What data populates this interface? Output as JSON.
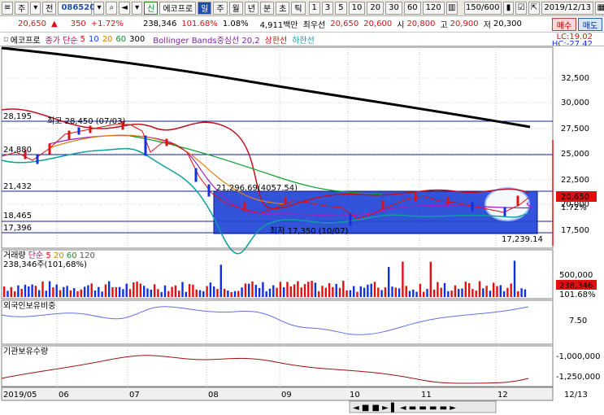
{
  "toolbar": {
    "menu_label": "주",
    "jeon_label": "전",
    "code": "086520",
    "sin_label": "신",
    "stock_name": "에코프로",
    "info_label": "일",
    "periods": [
      "주",
      "월",
      "년",
      "분",
      "초",
      "틱"
    ],
    "intervals": [
      "1",
      "3",
      "5",
      "10",
      "20",
      "30",
      "60",
      "120"
    ],
    "count": "150/600",
    "date": "2019/12/13"
  },
  "quote": {
    "price": "20,650",
    "change": "350",
    "change_pct": "+1.72%",
    "volume": "238,346",
    "vol_ratio": "101.68%",
    "turnover": "1.08%",
    "amount": "4,911백만",
    "best_ask_label": "최우선",
    "best_ask": "20,650",
    "best_bid": "20,600",
    "open_label": "시",
    "open": "20,800",
    "high_label": "고",
    "high": "20,900",
    "low_label": "저",
    "low": "20,300",
    "buy_label": "매수",
    "sell_label": "매도"
  },
  "legend": {
    "name": "에코프로",
    "ma_label": "종가 단순",
    "ma5": "5",
    "ma10": "10",
    "ma20": "20",
    "ma60": "60",
    "ma300": "300",
    "bb_label": "Bollinger Bands중심선 20,2",
    "bb_upper": "상한선",
    "bb_lower": "하한선",
    "lc": "LC:19.02",
    "hc": "HC:-27.42"
  },
  "price_axis": [
    "32,500",
    "30,000",
    "27,500",
    "25,000",
    "22,500",
    "20,000",
    "17,500"
  ],
  "price_levels": [
    "28,195",
    "24,880",
    "21,432",
    "18,465",
    "17,396"
  ],
  "annotations": {
    "high": "최고 28,450 (07/03)",
    "low": "최저 17,350 (10/07)",
    "mid": "21,296.69(4057.54)",
    "bottom_value": "17,239.14",
    "current_price": "20,650",
    "current_pct": "1.72%"
  },
  "volume_panel": {
    "label": "거래량",
    "ma_label": "단순",
    "ma5": "5",
    "ma20": "20",
    "ma60": "60",
    "ma120": "120",
    "value_text": "238,346주(101,68%)",
    "axis": "500,000",
    "current": "238,346",
    "current_pct": "101.68%"
  },
  "foreign_panel": {
    "label": "외국인보유비중",
    "axis": "7.50"
  },
  "inst_panel": {
    "label": "기관보유수량",
    "axis": [
      "-1,000,000",
      "-1,250,000"
    ]
  },
  "x_axis": [
    "2019/05",
    "06",
    "07",
    "08",
    "09",
    "10",
    "11",
    "12",
    "12/13"
  ],
  "colors": {
    "up": "#e01010",
    "down": "#1030e0",
    "box": "#1f3fd0",
    "ma300": "#000000",
    "bb": "#c01020"
  },
  "chart_data": [
    {
      "type": "line",
      "title": "",
      "series": [
        {
          "name": "300",
          "x": [
            "2019/05",
            "06",
            "07",
            "08",
            "09",
            "10",
            "11",
            "12",
            "12/13"
          ],
          "values": [
            33000,
            32400,
            31800,
            31200,
            30800,
            30200,
            29600,
            28700,
            27800
          ]
        },
        {
          "name": "5",
          "x": [
            "2019/05",
            "06",
            "07",
            "08",
            "09",
            "10",
            "11",
            "12",
            "12/13"
          ],
          "values": [
            24000,
            27200,
            27800,
            21400,
            19400,
            18200,
            20600,
            19800,
            20650
          ]
        }
      ],
      "ylim": [
        17000,
        33500
      ]
    },
    {
      "type": "bar",
      "title": "",
      "series": [
        {
          "name": "거래량",
          "values": []
        }
      ]
    }
  ]
}
